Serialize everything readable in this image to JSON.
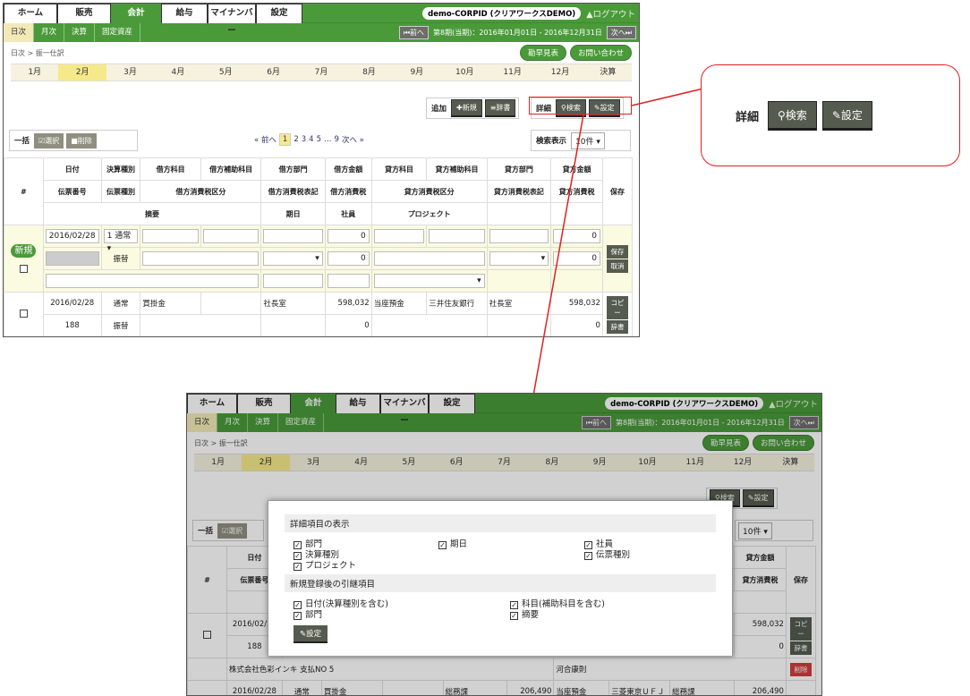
{
  "app": {
    "tabs": [
      "ホーム",
      "販売",
      "会計",
      "給与",
      "マイナンバー",
      "設定"
    ],
    "active_tab": "会計",
    "company": "demo-CORPID (クリアワークスDEMO)",
    "logout": "▲ログアウト",
    "subtabs": [
      "日次",
      "月次",
      "決算",
      "固定資産"
    ],
    "prev": "⏮前へ",
    "next": "次へ⏭",
    "period": "第8期(当期)：2016年01月01日 - 2016年12月31日",
    "breadcrumb": "日次 > 振一仕訳",
    "quick_btn": "勘早見表",
    "contact_btn": "お問い合わせ",
    "months": [
      "1月",
      "2月",
      "3月",
      "4月",
      "5月",
      "6月",
      "7月",
      "8月",
      "9月",
      "10月",
      "11月",
      "12月",
      "決算"
    ],
    "active_month": "2月"
  },
  "toolbar": {
    "add_label": "追加",
    "new_btn": "✚新規",
    "dict_btn": "≡辞書",
    "detail_label": "詳細",
    "search_btn": "⚲検索",
    "settings_btn": "✎設定",
    "bulk_label": "一括",
    "select_btn": "☑選択",
    "delete_btn": "■削除",
    "pager": [
      "« 前へ",
      "1",
      "2",
      "3",
      "4",
      "5",
      "…",
      "9",
      "次へ »"
    ],
    "search_display_label": "検索表示",
    "per_page": "10件",
    "per_page_caret": "▾"
  },
  "table": {
    "h_no": "#",
    "h_save": "保存",
    "h_row1": [
      "日付",
      "決算種別",
      "借方科目",
      "借方補助科目",
      "借方部門",
      "借方金額",
      "貸方科目",
      "貸方補助科目",
      "貸方部門",
      "貸方金額"
    ],
    "h_row2": [
      "伝票番号",
      "伝票種別",
      "借方消費税区分",
      "借方消費税表記",
      "借方消費税",
      "貸方消費税区分",
      "貸方消費税表記",
      "貸方消費税"
    ],
    "h_row3": [
      "摘要",
      "期日",
      "社員",
      "プロジェクト"
    ],
    "new_badge": "新規",
    "new_date": "2016/02/28",
    "new_type": "1 通常▾",
    "new_amt1": "0",
    "new_amt2": "0",
    "new_voucher": "振替",
    "new_tax1": "0",
    "new_tax2": "0",
    "save_btn": "保存",
    "cancel_btn": "取消",
    "row1": {
      "date": "2016/02/28",
      "type": "通常",
      "debit": "買掛金",
      "dept": "社長室",
      "amount": "598,032",
      "credit": "当座預金",
      "credit_sub": "三井住友銀行",
      "credit_dept": "社長室",
      "credit_amount": "598,032",
      "no": "188",
      "voucher": "振替",
      "tax": "0",
      "tax2": "0"
    },
    "copy_btn": "コピー",
    "dict_btn": "辞書",
    "del_btn": "削除",
    "row2_memo": "株式会社色彩インキ 支払NO 5",
    "row2_staff": "河合康則",
    "row3": {
      "date": "2016/02/28",
      "type": "通常",
      "debit": "買掛金",
      "dept": "総務課",
      "amount": "206,490",
      "credit": "当座預金",
      "credit_sub": "三菱東京ＵＦＪ",
      "credit_dept": "総務課",
      "credit_amount": "206,490"
    }
  },
  "callout": {
    "detail_label": "詳細",
    "search_btn": "⚲検索",
    "settings_btn": "✎設定"
  },
  "modal": {
    "sec1": "詳細項目の表示",
    "opts1": [
      "部門",
      "期日",
      "社員",
      "決算種別",
      "伝票種別",
      "プロジェクト"
    ],
    "sec2": "新規登録後の引継項目",
    "opts2": [
      "日付(決算種別を含む)",
      "科目(補助科目を含む)",
      "部門",
      "摘要"
    ],
    "check": "☑",
    "set_btn": "✎設定"
  }
}
